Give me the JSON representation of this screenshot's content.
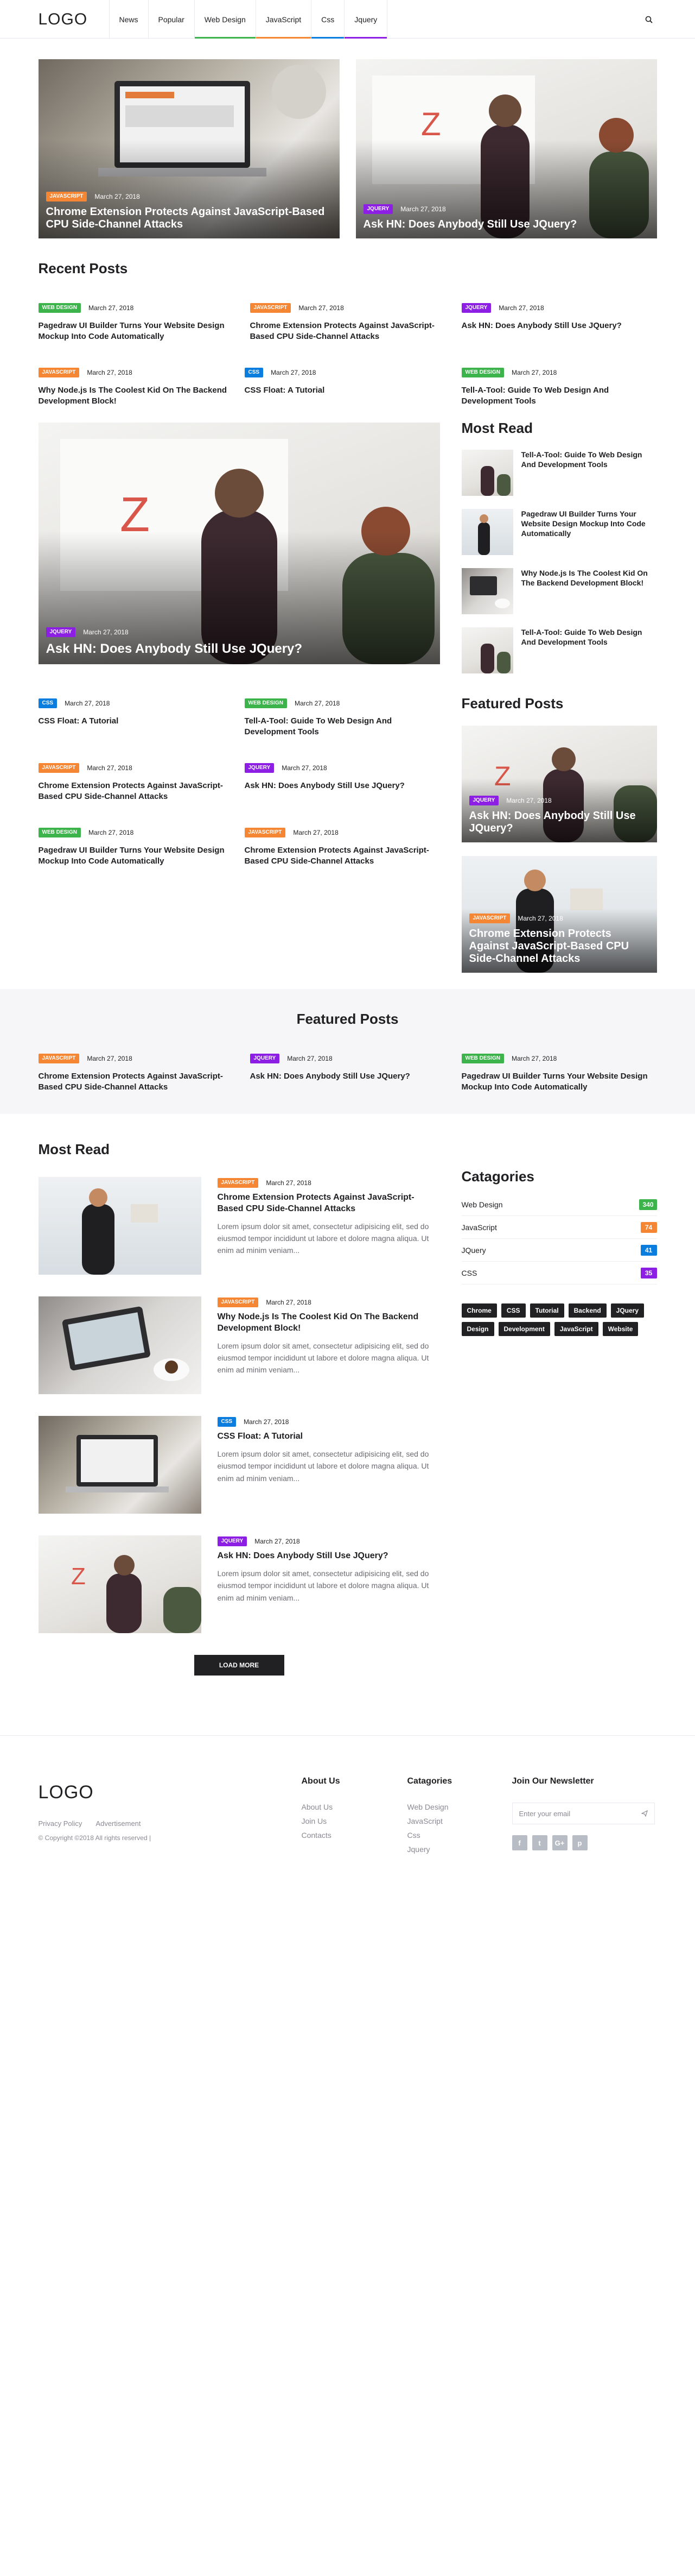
{
  "header": {
    "logo": "LOGO",
    "nav": [
      {
        "label": "News",
        "color": ""
      },
      {
        "label": "Popular",
        "color": ""
      },
      {
        "label": "Web Design",
        "color": "#3cb34b"
      },
      {
        "label": "JavaScript",
        "color": "#f58634"
      },
      {
        "label": "Css",
        "color": "#0a7dde"
      },
      {
        "label": "Jquery",
        "color": "#8d1ee3"
      }
    ]
  },
  "colors": {
    "web_design": "#3cb34b",
    "javascript": "#f58634",
    "css": "#0a7dde",
    "jquery": "#8d1ee3",
    "dark": "#212124"
  },
  "hero": [
    {
      "category": "JAVASCRIPT",
      "date": "March 27, 2018",
      "title": "Chrome Extension Protects Against JavaScript-Based CPU Side-Channel Attacks"
    },
    {
      "category": "JQUERY",
      "date": "March 27, 2018",
      "title": "Ask HN: Does Anybody Still Use JQuery?"
    }
  ],
  "recent": {
    "title": "Recent Posts",
    "top": [
      {
        "category": "WEB DESIGN",
        "date": "March 27, 2018",
        "title": "Pagedraw UI Builder Turns Your Website Design Mockup Into Code Automatically"
      },
      {
        "category": "JAVASCRIPT",
        "date": "March 27, 2018",
        "title": "Chrome Extension Protects Against JavaScript-Based CPU Side-Channel Attacks"
      },
      {
        "category": "JQUERY",
        "date": "March 27, 2018",
        "title": "Ask HN: Does Anybody Still Use JQuery?"
      },
      {
        "category": "JAVASCRIPT",
        "date": "March 27, 2018",
        "title": "Why Node.js Is The Coolest Kid On The Backend Development Block!"
      },
      {
        "category": "CSS",
        "date": "March 27, 2018",
        "title": "CSS Float: A Tutorial"
      },
      {
        "category": "WEB DESIGN",
        "date": "March 27, 2018",
        "title": "Tell-A-Tool: Guide To Web Design And Development Tools"
      }
    ],
    "big": {
      "category": "JQUERY",
      "date": "March 27, 2018",
      "title": "Ask HN: Does Anybody Still Use JQuery?"
    },
    "cards": [
      {
        "category": "CSS",
        "date": "March 27, 2018",
        "title": "CSS Float: A Tutorial"
      },
      {
        "category": "WEB DESIGN",
        "date": "March 27, 2018",
        "title": "Tell-A-Tool: Guide To Web Design And Development Tools"
      },
      {
        "category": "JAVASCRIPT",
        "date": "March 27, 2018",
        "title": "Chrome Extension Protects Against JavaScript-Based CPU Side-Channel Attacks"
      },
      {
        "category": "JQUERY",
        "date": "March 27, 2018",
        "title": "Ask HN: Does Anybody Still Use JQuery?"
      },
      {
        "category": "WEB DESIGN",
        "date": "March 27, 2018",
        "title": "Pagedraw UI Builder Turns Your Website Design Mockup Into Code Automatically"
      },
      {
        "category": "JAVASCRIPT",
        "date": "March 27, 2018",
        "title": "Chrome Extension Protects Against JavaScript-Based CPU Side-Channel Attacks"
      }
    ]
  },
  "sidebar": {
    "most_read_title": "Most Read",
    "most_read": [
      {
        "title": "Tell-A-Tool: Guide To Web Design And Development Tools"
      },
      {
        "title": "Pagedraw UI Builder Turns Your Website Design Mockup Into Code Automatically"
      },
      {
        "title": "Why Node.js Is The Coolest Kid On The Backend Development Block!"
      },
      {
        "title": "Tell-A-Tool: Guide To Web Design And Development Tools"
      }
    ],
    "featured_title": "Featured Posts",
    "featured": [
      {
        "category": "JQUERY",
        "date": "March 27, 2018",
        "title": "Ask HN: Does Anybody Still Use JQuery?"
      },
      {
        "category": "JAVASCRIPT",
        "date": "March 27, 2018",
        "title": "Chrome Extension Protects Against JavaScript-Based CPU Side-Channel Attacks"
      }
    ]
  },
  "featured_band": {
    "title": "Featured Posts",
    "cards": [
      {
        "category": "JAVASCRIPT",
        "date": "March 27, 2018",
        "title": "Chrome Extension Protects Against JavaScript-Based CPU Side-Channel Attacks"
      },
      {
        "category": "JQUERY",
        "date": "March 27, 2018",
        "title": "Ask HN: Does Anybody Still Use JQuery?"
      },
      {
        "category": "WEB DESIGN",
        "date": "March 27, 2018",
        "title": "Pagedraw UI Builder Turns Your Website Design Mockup Into Code Automatically"
      }
    ]
  },
  "most_read": {
    "title": "Most Read",
    "items": [
      {
        "category": "JAVASCRIPT",
        "date": "March 27, 2018",
        "title": "Chrome Extension Protects Against JavaScript-Based CPU Side-Channel Attacks",
        "text": "Lorem ipsum dolor sit amet, consectetur adipisicing elit, sed do eiusmod tempor incididunt ut labore et dolore magna aliqua. Ut enim ad minim veniam..."
      },
      {
        "category": "JAVASCRIPT",
        "date": "March 27, 2018",
        "title": "Why Node.js Is The Coolest Kid On The Backend Development Block!",
        "text": "Lorem ipsum dolor sit amet, consectetur adipisicing elit, sed do eiusmod tempor incididunt ut labore et dolore magna aliqua. Ut enim ad minim veniam..."
      },
      {
        "category": "CSS",
        "date": "March 27, 2018",
        "title": "CSS Float: A Tutorial",
        "text": "Lorem ipsum dolor sit amet, consectetur adipisicing elit, sed do eiusmod tempor incididunt ut labore et dolore magna aliqua. Ut enim ad minim veniam..."
      },
      {
        "category": "JQUERY",
        "date": "March 27, 2018",
        "title": "Ask HN: Does Anybody Still Use JQuery?",
        "text": "Lorem ipsum dolor sit amet, consectetur adipisicing elit, sed do eiusmod tempor incididunt ut labore et dolore magna aliqua. Ut enim ad minim veniam..."
      }
    ],
    "load_more": "LOAD MORE"
  },
  "categories": {
    "title": "Catagories",
    "items": [
      {
        "label": "Web Design",
        "count": "340",
        "color": "#3cb34b"
      },
      {
        "label": "JavaScript",
        "count": "74",
        "color": "#f58634"
      },
      {
        "label": "JQuery",
        "count": "41",
        "color": "#0a7dde"
      },
      {
        "label": "CSS",
        "count": "35",
        "color": "#8d1ee3"
      }
    ],
    "tags": [
      "Chrome",
      "CSS",
      "Tutorial",
      "Backend",
      "JQuery",
      "Design",
      "Development",
      "JavaScript",
      "Website"
    ]
  },
  "footer": {
    "logo": "LOGO",
    "links_inline": [
      "Privacy Policy",
      "Advertisement"
    ],
    "copyright": "© Copyright ©2018 All rights reserved |",
    "about_title": "About Us",
    "about_links": [
      "About Us",
      "Join Us",
      "Contacts"
    ],
    "cat_title": "Catagories",
    "cat_links": [
      "Web Design",
      "JavaScript",
      "Css",
      "Jquery"
    ],
    "newsletter_title": "Join Our Newsletter",
    "newsletter_placeholder": "Enter your email",
    "social": [
      "f",
      "t",
      "G+",
      "p"
    ]
  }
}
